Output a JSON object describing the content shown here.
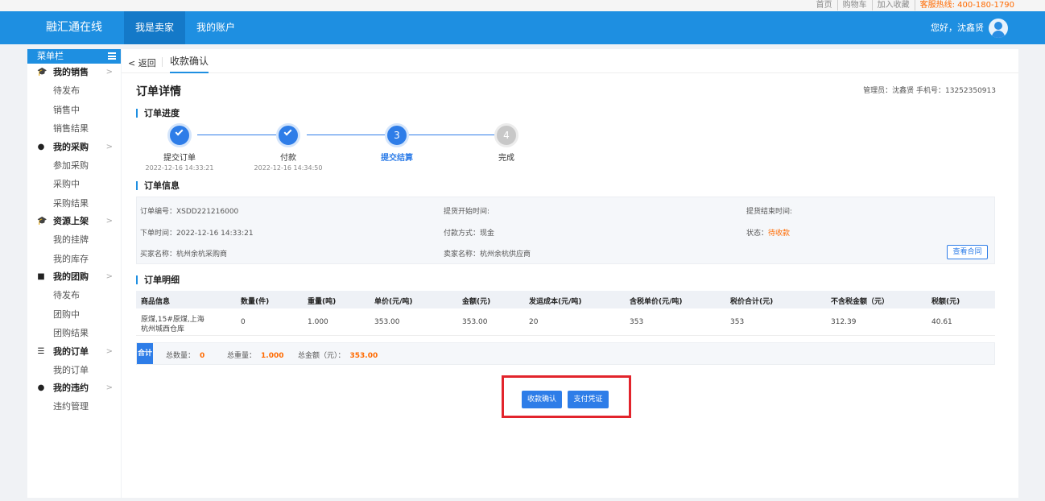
{
  "topbar": {
    "links": [
      "首页",
      "购物车",
      "加入收藏"
    ],
    "hotline": "客服热线: 400-180-1790"
  },
  "header": {
    "brand": "融汇通在线",
    "nav": [
      "我是卖家",
      "我的账户"
    ],
    "greeting": "您好，沈鑫贤"
  },
  "sidebar": {
    "title": "菜单栏",
    "groups": [
      {
        "label": "我的销售",
        "items": [
          "待发布",
          "销售中",
          "销售结果"
        ]
      },
      {
        "label": "我的采购",
        "items": [
          "参加采购",
          "采购中",
          "采购结果"
        ]
      },
      {
        "label": "资源上架",
        "items": [
          "我的挂牌",
          "我的库存"
        ]
      },
      {
        "label": "我的团购",
        "items": [
          "待发布",
          "团购中",
          "团购结果"
        ]
      },
      {
        "label": "我的订单",
        "items": [
          "我的订单"
        ]
      },
      {
        "label": "我的违约",
        "items": [
          "违约管理"
        ]
      }
    ]
  },
  "tabs": {
    "back": "< 返回",
    "current": "收款确认"
  },
  "page": {
    "title": "订单详情",
    "admin": "管理员：沈鑫贤  手机号：13252350913"
  },
  "progress": {
    "title": "订单进度",
    "steps": [
      {
        "num": "1",
        "label": "提交订单",
        "time": "2022-12-16 14:33:21"
      },
      {
        "num": "2",
        "label": "付款",
        "time": "2022-12-16 14:34:50"
      },
      {
        "num": "3",
        "label": "提交结算",
        "time": ""
      },
      {
        "num": "4",
        "label": "完成",
        "time": ""
      }
    ]
  },
  "info": {
    "title": "订单信息",
    "order_no": "订单编号：XSDD221216000",
    "pickup_start": "提货开始时间:",
    "pickup_end": "提货结束时间:",
    "order_time": "下单时间：2022-12-16 14:33:21",
    "pay_method": "付款方式：现金",
    "status_label": "状态：",
    "status_value": "待收款",
    "buyer": "买家名称：杭州余杭采购商",
    "seller": "卖家名称：杭州余杭供应商",
    "contract_btn": "查看合同"
  },
  "detail": {
    "title": "订单明细",
    "headers": [
      "商品信息",
      "数量(件)",
      "重量(吨)",
      "单价(元/吨)",
      "金额(元)",
      "发运成本(元/吨)",
      "含税单价(元/吨)",
      "税价合计(元)",
      "不含税金额（元）",
      "税额(元)"
    ],
    "row": {
      "product_line1": "原煤,15#原煤,上海",
      "product_line2": "杭州城西仓库",
      "qty": "0",
      "weight": "1.000",
      "price": "353.00",
      "amount": "353.00",
      "ship_cost": "20",
      "tax_price": "353",
      "tax_total": "353",
      "net_amount": "312.39",
      "tax": "40.61"
    }
  },
  "totals": {
    "tag": "合计",
    "qty_label": "总数量：",
    "qty_value": "0",
    "weight_label": "总重量：",
    "weight_value": "1.000",
    "amount_label": "总金额（元）：",
    "amount_value": "353.00"
  },
  "actions": {
    "confirm": "收款确认",
    "voucher": "支付凭证"
  },
  "colors": {
    "primary": "#1e8fe1",
    "button": "#2e7de8",
    "warn": "#ff6a00",
    "highlight": "#e2242c"
  }
}
